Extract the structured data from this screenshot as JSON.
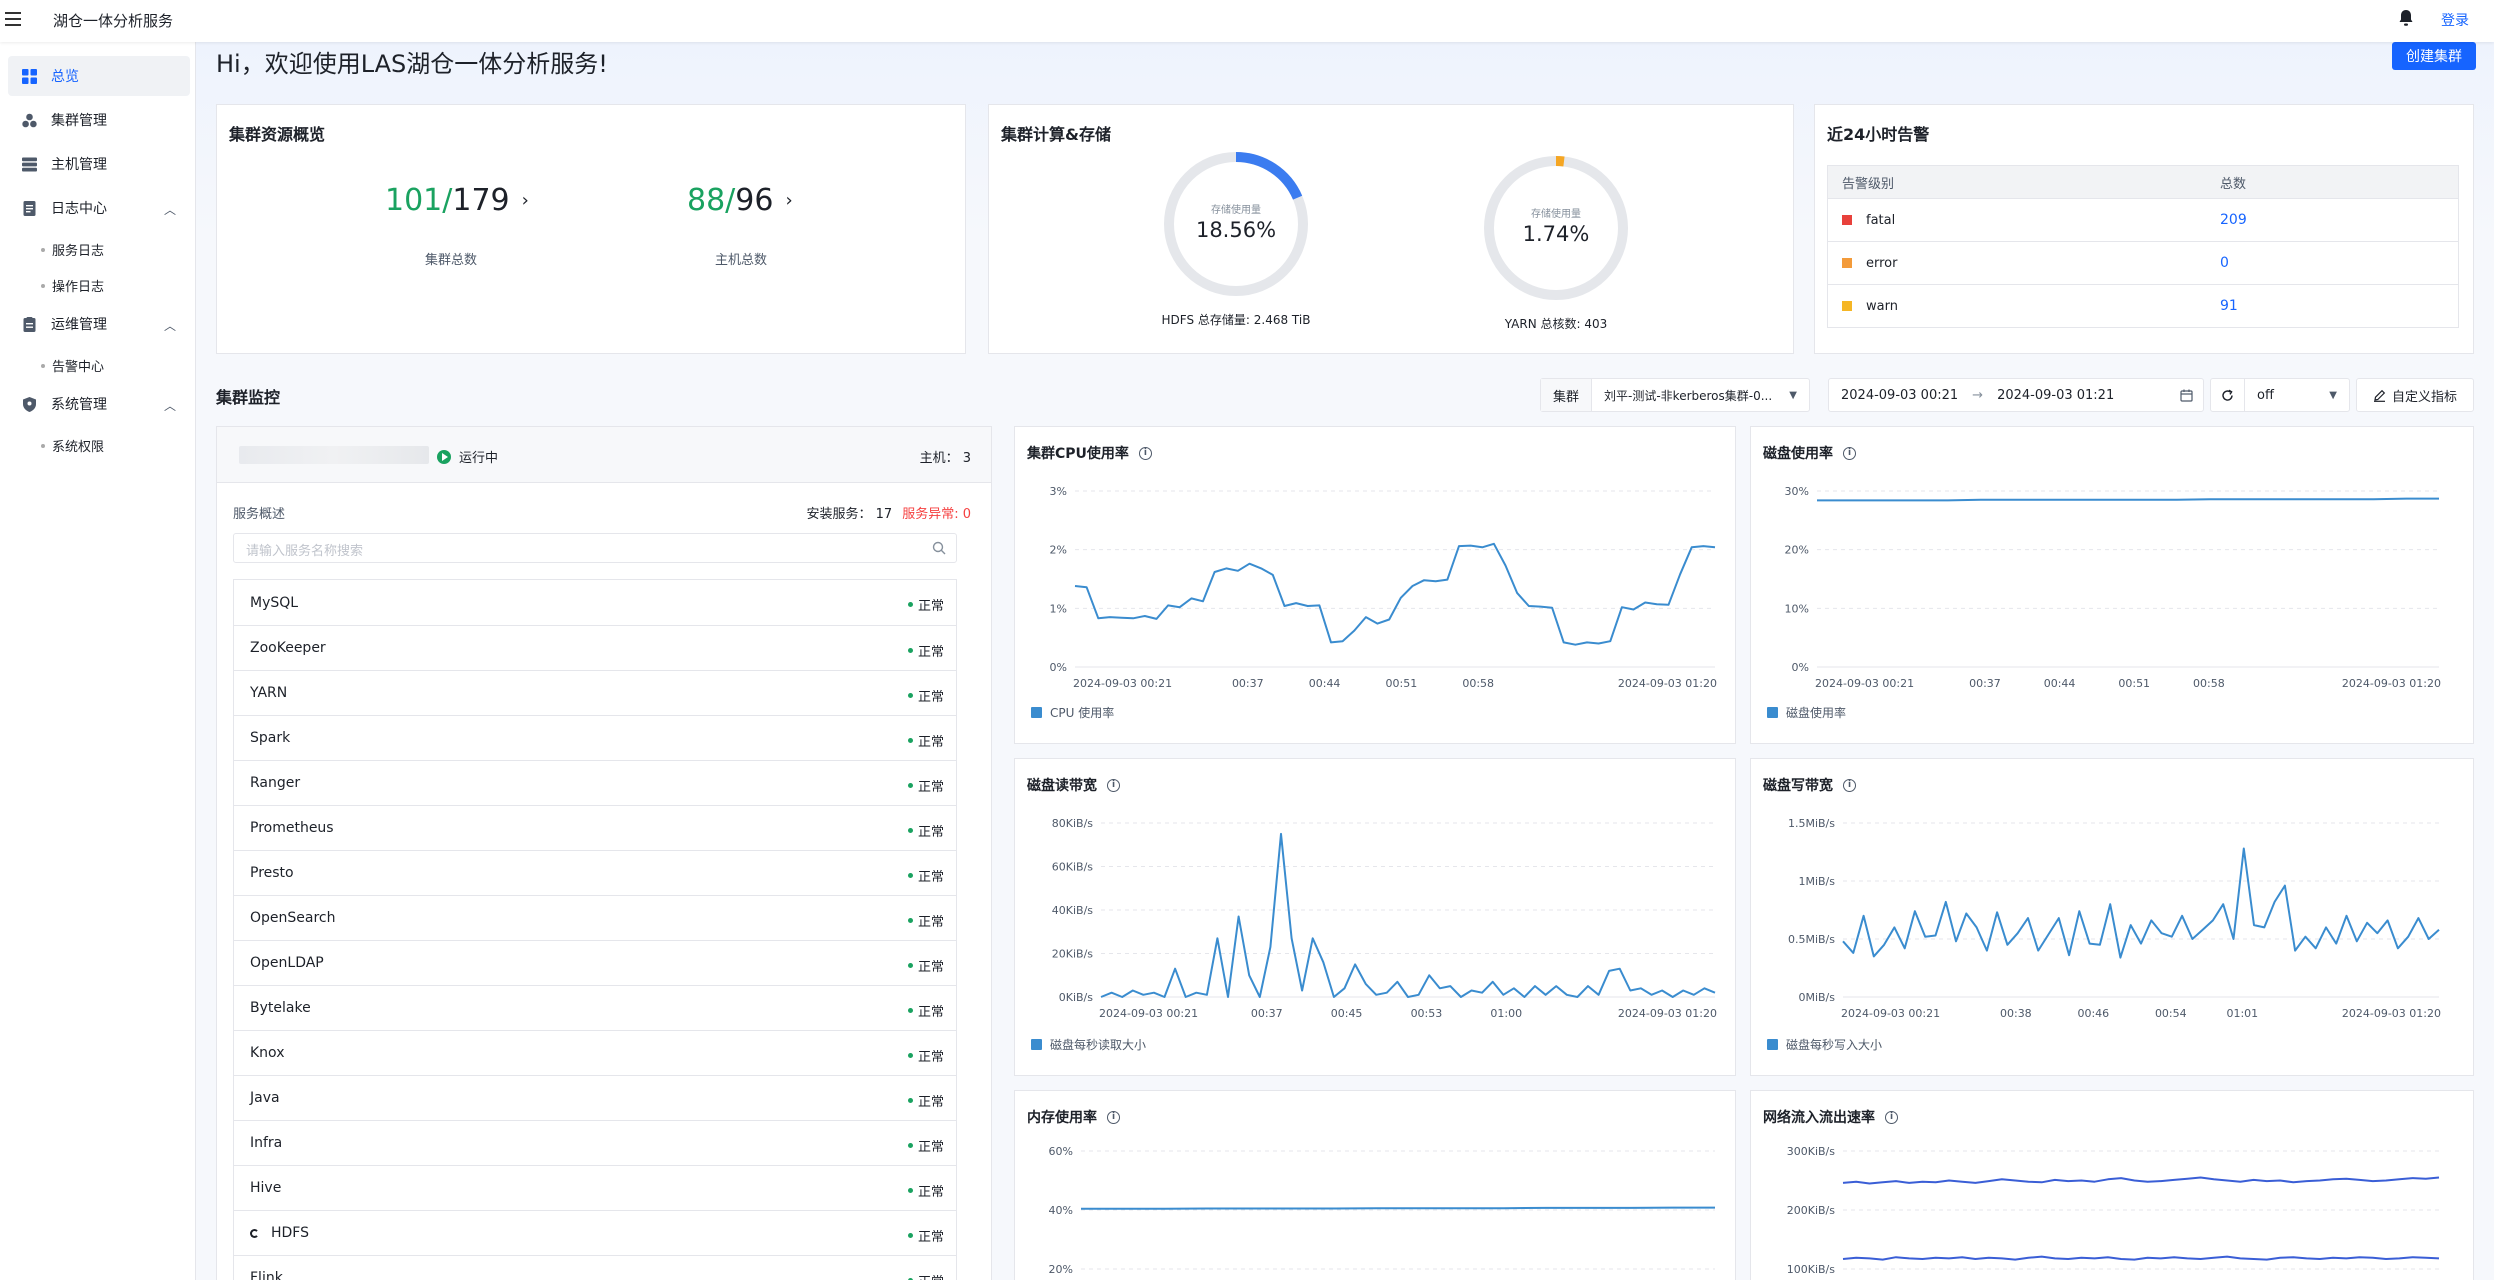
{
  "app": {
    "title": "湖仓一体分析服务",
    "login": "登录"
  },
  "sidebar": {
    "overview": "总览",
    "cluster_mgmt": "集群管理",
    "host_mgmt": "主机管理",
    "log_center": "日志中心",
    "service_log": "服务日志",
    "operation_log": "操作日志",
    "ops_mgmt": "运维管理",
    "alert_center": "告警中心",
    "system_mgmt": "系统管理",
    "system_perm": "系统权限"
  },
  "main": {
    "greeting": "Hi，欢迎使用LAS湖仓一体分析服务!",
    "create_cluster": "创建集群"
  },
  "resource_overview": {
    "title": "集群资源概览",
    "clusters_running": "101/",
    "clusters_total": "179",
    "clusters_label": "集群总数",
    "hosts_running": "88/",
    "hosts_total": "96",
    "hosts_label": "主机总数"
  },
  "compute_storage": {
    "title": "集群计算&存储",
    "hdfs": {
      "inner_label": "存储使用量",
      "percent": "18.56%",
      "fraction": 0.1856,
      "caption": "HDFS 总存储量: 2.468 TiB"
    },
    "yarn": {
      "inner_label": "存储使用量",
      "percent": "1.74%",
      "fraction": 0.0174,
      "caption": "YARN 总核数: 403"
    },
    "colors": {
      "hdfs": "#3b7cf0",
      "yarn": "#f5a623",
      "track": "#e5e7eb"
    }
  },
  "alerts": {
    "title": "近24小时告警",
    "col_level": "告警级别",
    "col_total": "总数",
    "rows": [
      {
        "level": "fatal",
        "count": "209",
        "color": "#e8413b"
      },
      {
        "level": "error",
        "count": "0",
        "color": "#f39b3a"
      },
      {
        "level": "warn",
        "count": "91",
        "color": "#f5b625"
      }
    ]
  },
  "monitor": {
    "title": "集群监控",
    "cluster_label": "集群",
    "cluster_value": "刘平-测试-非kerberos集群-0...",
    "start_time": "2024-09-03 00:21",
    "end_time": "2024-09-03 01:21",
    "refresh": "off",
    "custom_metrics": "自定义指标"
  },
  "service_panel": {
    "status": "运行中",
    "hosts": "主机： 3",
    "overview_label": "服务概述",
    "installed": "安装服务： 17",
    "abnormal": "服务异常: 0",
    "search_placeholder": "请输入服务名称搜索",
    "status_ok": "正常",
    "services": [
      "MySQL",
      "ZooKeeper",
      "YARN",
      "Spark",
      "Ranger",
      "Prometheus",
      "Presto",
      "OpenSearch",
      "OpenLDAP",
      "Bytelake",
      "Knox",
      "Java",
      "Infra",
      "Hive",
      "HDFS",
      "Flink"
    ]
  },
  "chart_data": [
    {
      "type": "line",
      "title": "集群CPU使用率",
      "legend": "CPU 使用率",
      "y_ticks": [
        "3%",
        "2%",
        "1%",
        "0%"
      ],
      "ylim": [
        0,
        3
      ],
      "x_ticks": [
        "2024-09-03 00:21",
        "00:37",
        "00:44",
        "00:51",
        "00:58",
        "2024-09-03 01:20"
      ],
      "values": [
        1.38,
        1.36,
        0.83,
        0.85,
        0.84,
        0.83,
        0.87,
        0.82,
        1.05,
        1.02,
        1.17,
        1.12,
        1.62,
        1.68,
        1.64,
        1.76,
        1.68,
        1.57,
        1.04,
        1.09,
        1.04,
        1.05,
        0.42,
        0.44,
        0.62,
        0.85,
        0.74,
        0.81,
        1.18,
        1.38,
        1.48,
        1.46,
        1.49,
        2.06,
        2.07,
        2.04,
        2.1,
        1.73,
        1.26,
        1.04,
        1.03,
        1.01,
        0.42,
        0.38,
        0.42,
        0.4,
        0.44,
        1.02,
        0.98,
        1.1,
        1.07,
        1.06,
        1.58,
        2.04,
        2.06,
        2.04
      ],
      "color": "#3a8ccf"
    },
    {
      "type": "line",
      "title": "磁盘使用率",
      "legend": "磁盘使用率",
      "y_ticks": [
        "30%",
        "20%",
        "10%",
        "0%"
      ],
      "ylim": [
        0,
        30
      ],
      "x_ticks": [
        "2024-09-03 00:21",
        "00:37",
        "00:44",
        "00:51",
        "00:58",
        "2024-09-03 01:20"
      ],
      "values": [
        28.4,
        28.4,
        28.4,
        28.4,
        28.4,
        28.5,
        28.5,
        28.5,
        28.5,
        28.5,
        28.5,
        28.5,
        28.6,
        28.6,
        28.6,
        28.6,
        28.6,
        28.6,
        28.7,
        28.7
      ],
      "color": "#3a8ccf"
    },
    {
      "type": "line",
      "title": "磁盘读带宽",
      "legend": "磁盘每秒读取大小",
      "y_ticks": [
        "80KiB/s",
        "60KiB/s",
        "40KiB/s",
        "20KiB/s",
        "0KiB/s"
      ],
      "ylim": [
        0,
        80
      ],
      "x_ticks": [
        "2024-09-03 00:21",
        "00:37",
        "00:45",
        "00:53",
        "01:00",
        "2024-09-03 01:20"
      ],
      "values": [
        0,
        2,
        0,
        3,
        1,
        2,
        0,
        13,
        0,
        2,
        1,
        27,
        0,
        37,
        10,
        0,
        23,
        75,
        27,
        3,
        27,
        16,
        0,
        4,
        15,
        6,
        1,
        2,
        7,
        0,
        1,
        10,
        4,
        5,
        0,
        3,
        2,
        7,
        1,
        4,
        0,
        5,
        1,
        5,
        1,
        0,
        5,
        1,
        12,
        13,
        3,
        4,
        1,
        3,
        0,
        3,
        1,
        4,
        2
      ],
      "color": "#3a8ccf"
    },
    {
      "type": "line",
      "title": "磁盘写带宽",
      "legend": "磁盘每秒写入大小",
      "y_ticks": [
        "1.5MiB/s",
        "1MiB/s",
        "0.5MiB/s",
        "0MiB/s"
      ],
      "ylim": [
        0,
        1.5
      ],
      "x_ticks": [
        "2024-09-03 00:21",
        "00:38",
        "00:46",
        "00:54",
        "01:01",
        "2024-09-03 01:20"
      ],
      "values": [
        0.48,
        0.38,
        0.7,
        0.35,
        0.45,
        0.6,
        0.42,
        0.74,
        0.52,
        0.53,
        0.82,
        0.48,
        0.72,
        0.6,
        0.4,
        0.73,
        0.45,
        0.55,
        0.68,
        0.4,
        0.54,
        0.68,
        0.36,
        0.74,
        0.46,
        0.45,
        0.8,
        0.34,
        0.62,
        0.46,
        0.66,
        0.55,
        0.52,
        0.7,
        0.5,
        0.58,
        0.66,
        0.8,
        0.5,
        1.28,
        0.62,
        0.6,
        0.82,
        0.96,
        0.4,
        0.52,
        0.42,
        0.6,
        0.46,
        0.7,
        0.48,
        0.64,
        0.55,
        0.66,
        0.42,
        0.52,
        0.68,
        0.5,
        0.58
      ],
      "color": "#3a8ccf"
    },
    {
      "type": "line",
      "title": "内存使用率",
      "y_ticks": [
        "60%",
        "40%",
        "20%"
      ],
      "ylim": [
        20,
        60
      ],
      "values": [
        40.4,
        40.4,
        40.4,
        40.5,
        40.5,
        40.5,
        40.5,
        40.6,
        40.6,
        40.6,
        40.6,
        40.7,
        40.7,
        40.7,
        40.8,
        40.8
      ],
      "color": "#3a8ccf"
    },
    {
      "type": "line",
      "title": "网络流入流出速率",
      "y_ticks": [
        "300KiB/s",
        "200KiB/s",
        "100KiB/s"
      ],
      "ylim": [
        100,
        300
      ],
      "series": [
        {
          "values": [
            246,
            248,
            245,
            247,
            249,
            246,
            248,
            247,
            250,
            248,
            246,
            249,
            252,
            250,
            248,
            247,
            251,
            249,
            250,
            248,
            252,
            254,
            250,
            248,
            249,
            251,
            253,
            255,
            252,
            250,
            248,
            251,
            249,
            250,
            247,
            249,
            250,
            252,
            253,
            251,
            249,
            250,
            252,
            254,
            253,
            255
          ]
        },
        {
          "values": [
            117,
            119,
            118,
            116,
            120,
            118,
            117,
            119,
            118,
            120,
            117,
            119,
            118,
            116,
            119,
            121,
            118,
            117,
            119,
            118,
            120,
            117,
            116,
            119,
            118,
            120,
            118,
            117,
            119,
            121,
            118,
            117,
            116,
            119,
            120,
            118,
            117,
            119,
            118,
            120,
            119,
            117,
            118,
            120,
            119,
            118
          ]
        }
      ],
      "color": "#3a5ed6"
    }
  ]
}
